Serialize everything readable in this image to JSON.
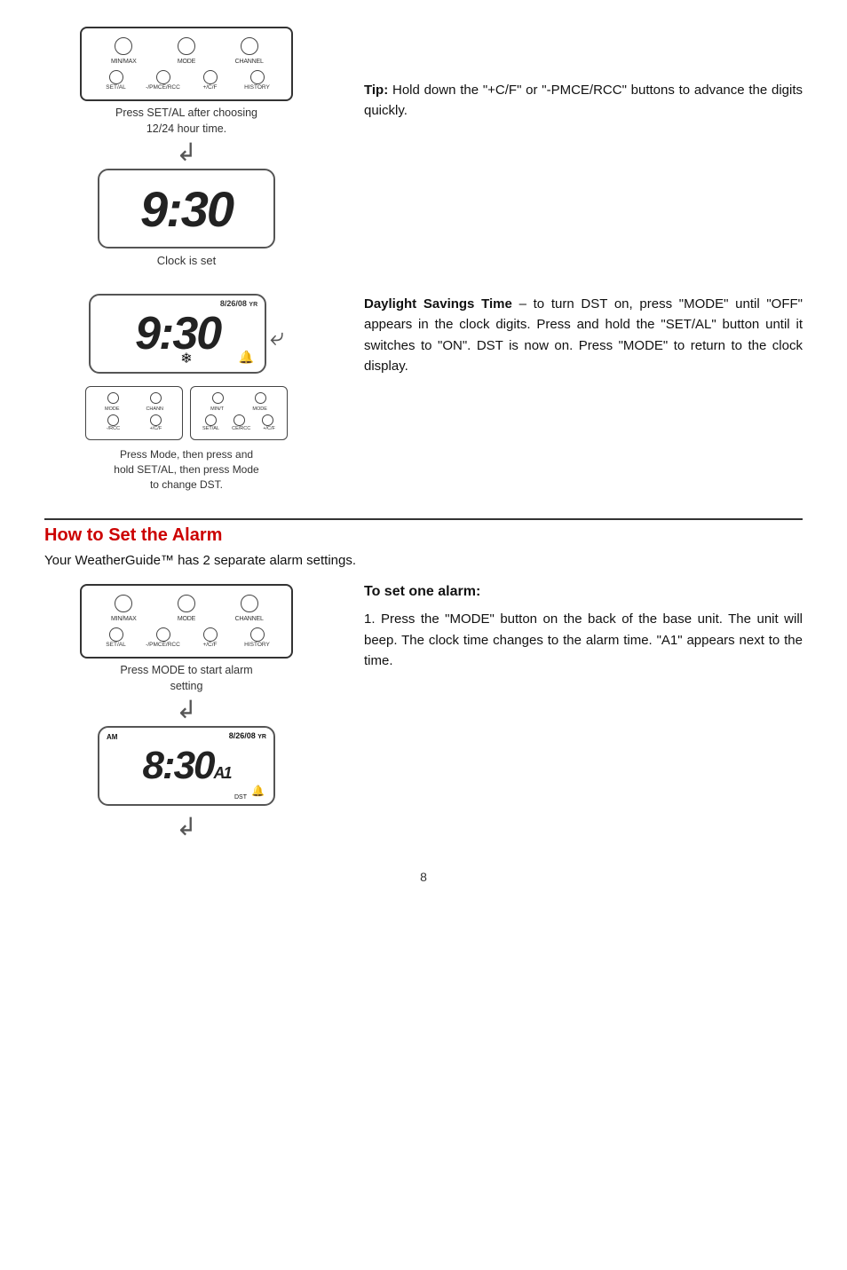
{
  "page": {
    "number": "8"
  },
  "clock_set_section": {
    "device": {
      "top_buttons": [
        "MIN/MAX",
        "MODE",
        "CHANNEL"
      ],
      "bottom_buttons": [
        "SET/AL",
        "-/PMCE/RCC",
        "+/C/F",
        "HISTORY"
      ]
    },
    "caption": "Press SET/AL after choosing\n12/24 hour time.",
    "clock_time": "9:30",
    "clock_label": "Clock is set",
    "tip_title": "Tip:",
    "tip_body": "Hold down the \"+C/F\" or \"-PMCE/RCC\" buttons to advance the digits quickly."
  },
  "dst_section": {
    "clock_time": "9:30",
    "date_overlay": "8/26/08",
    "yr_label": "YR",
    "caption": "Press Mode, then press and\nhold SET/AL, then press Mode\nto change DST.",
    "title": "Daylight Savings Time",
    "body": "– to turn DST on, press \"MODE\" until \"OFF\" appears in the clock digits. Press and hold the \"SET/AL\" button until it switches to \"ON\". DST is now on. Press \"MODE\" to return to the clock display.",
    "left_device": {
      "top_buttons": [
        "MODE",
        "CHANN"
      ],
      "bottom_buttons": [
        "-/RCC",
        "+/C/F"
      ]
    },
    "right_device": {
      "top_buttons": [
        "MIN/T",
        "MODE"
      ],
      "bottom_buttons": [
        "SET/AL",
        "CE/RCC",
        "+/C/F"
      ]
    }
  },
  "alarm_section": {
    "section_title": "How to Set the Alarm",
    "subtitle": "Your WeatherGuide™ has 2 separate alarm settings.",
    "device_caption": "Press MODE to start alarm\nsetting",
    "device": {
      "top_buttons": [
        "MIN/MAX",
        "MODE",
        "CHANNEL"
      ],
      "bottom_buttons": [
        "SET/AL",
        "-/PMCE/RCC",
        "+/C/F",
        "HISTORY"
      ]
    },
    "alarm_clock_time": "8:30",
    "alarm_am": "AM",
    "alarm_a1": "A1",
    "alarm_date": "8/26/08",
    "alarm_yr": "YR",
    "alarm_dst": "DST",
    "sub_title": "To set one alarm:",
    "instructions": "1. Press the \"MODE\" button on the back of the base unit. The unit will beep. The clock time changes to the alarm time. \"A1\" appears next to the time."
  }
}
